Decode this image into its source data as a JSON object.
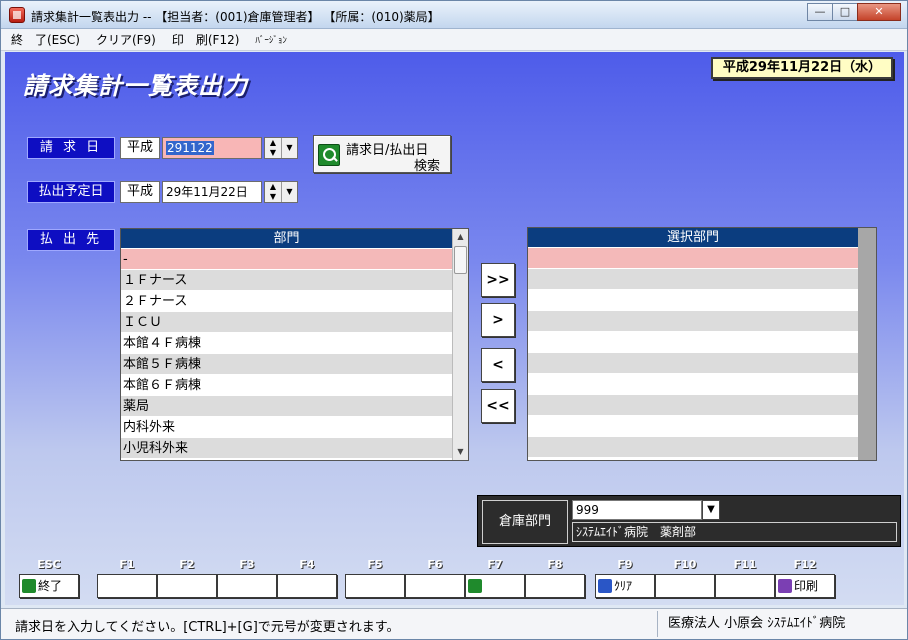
{
  "window": {
    "title": "請求集計一覧表出力 -- 【担当者：(001)倉庫管理者】 【所属：(010)薬局】",
    "minimize": "—",
    "maximize": "□",
    "close": "✕"
  },
  "menu": [
    {
      "label": "終　了(ESC)"
    },
    {
      "label": "クリア(F9)"
    },
    {
      "label": "印　刷(F12)"
    },
    {
      "label": "ﾊﾞｰｼﾞｮﾝ"
    }
  ],
  "page": {
    "title": "請求集計一覧表出力",
    "date_badge": "平成29年11月22日（水）"
  },
  "form": {
    "billing_date": {
      "label": "請 求 日",
      "era": "平成",
      "value": "291122"
    },
    "search_button": {
      "line1": "請求日/払出日",
      "line2": "検索"
    },
    "scheduled_date": {
      "label": "払出予定日",
      "era": "平成",
      "value": "29年11月22日"
    },
    "destination_label": "払 出 先"
  },
  "dept_list": {
    "header": "部門",
    "rows": [
      "-",
      "１Ｆナース",
      "２Ｆナース",
      "ＩＣＵ",
      "本館４Ｆ病棟",
      "本館５Ｆ病棟",
      "本館６Ｆ病棟",
      "薬局",
      "内科外来",
      "小児科外来"
    ]
  },
  "move_buttons": {
    "add_all": ">>",
    "add": ">",
    "remove": "<",
    "remove_all": "<<"
  },
  "selected_list": {
    "header": "選択部門"
  },
  "warehouse": {
    "label": "倉庫部門",
    "code": "999",
    "name": "ｼｽﾃﾑｴｲﾄﾞ病院　薬剤部"
  },
  "fkeys": [
    {
      "key": "ESC",
      "label": "終了",
      "icon": "exit-icon"
    },
    {
      "key": "F1",
      "label": ""
    },
    {
      "key": "F2",
      "label": ""
    },
    {
      "key": "F3",
      "label": ""
    },
    {
      "key": "F4",
      "label": ""
    },
    {
      "key": "F5",
      "label": ""
    },
    {
      "key": "F6",
      "label": ""
    },
    {
      "key": "F7",
      "label": "",
      "icon": "search-icon"
    },
    {
      "key": "F8",
      "label": ""
    },
    {
      "key": "F9",
      "label": "ｸﾘｱ",
      "icon": "check-icon"
    },
    {
      "key": "F10",
      "label": ""
    },
    {
      "key": "F11",
      "label": ""
    },
    {
      "key": "F12",
      "label": "印刷",
      "icon": "print-icon"
    }
  ],
  "status": {
    "message": "請求日を入力してください。[CTRL]+[G]で元号が変更されます。",
    "organization": "医療法人 小原会 ｼｽﾃﾑｴｲﾄﾞ病院"
  },
  "colors": {
    "label_bg": "#0e0ec2",
    "list_header_bg": "#0b3d7f",
    "selected_row": "#f4b9b9",
    "date_badge_bg": "#fffdc4"
  }
}
